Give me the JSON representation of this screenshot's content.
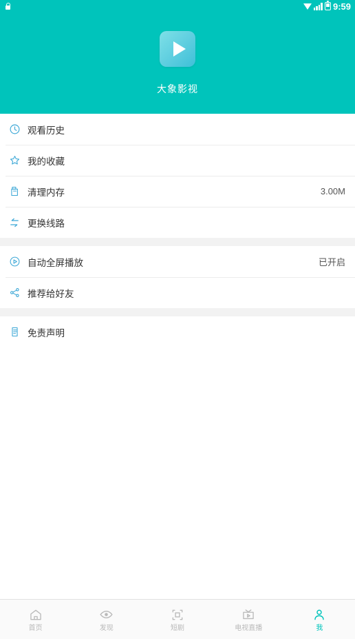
{
  "status_bar": {
    "time": "9:59",
    "icons": [
      "lock-icon",
      "triangle-down-icon",
      "signal-icon",
      "battery-icon"
    ]
  },
  "header": {
    "app_name": "大象影视",
    "logo_icon": "play-icon",
    "background_color": "#00c4bb"
  },
  "menu": {
    "groups": [
      {
        "items": [
          {
            "icon": "history-clock-icon",
            "label": "观看历史",
            "value": ""
          },
          {
            "icon": "star-icon",
            "label": "我的收藏",
            "value": ""
          },
          {
            "icon": "broom-clean-icon",
            "label": "清理内存",
            "value": "3.00M"
          },
          {
            "icon": "swap-lines-icon",
            "label": "更换线路",
            "value": ""
          }
        ]
      },
      {
        "items": [
          {
            "icon": "play-circle-icon",
            "label": "自动全屏播放",
            "value": "已开启"
          },
          {
            "icon": "share-nodes-icon",
            "label": "推荐给好友",
            "value": ""
          }
        ]
      },
      {
        "items": [
          {
            "icon": "document-icon",
            "label": "免责声明",
            "value": ""
          }
        ]
      }
    ]
  },
  "tabbar": {
    "items": [
      {
        "icon": "home-icon",
        "label": "首页",
        "active": false
      },
      {
        "icon": "eye-icon",
        "label": "发现",
        "active": false
      },
      {
        "icon": "frame-icon",
        "label": "短剧",
        "active": false
      },
      {
        "icon": "tv-play-icon",
        "label": "电视直播",
        "active": false
      },
      {
        "icon": "person-icon",
        "label": "我",
        "active": true
      }
    ],
    "active_color": "#00c4bb",
    "inactive_color": "#b9b9b9"
  }
}
